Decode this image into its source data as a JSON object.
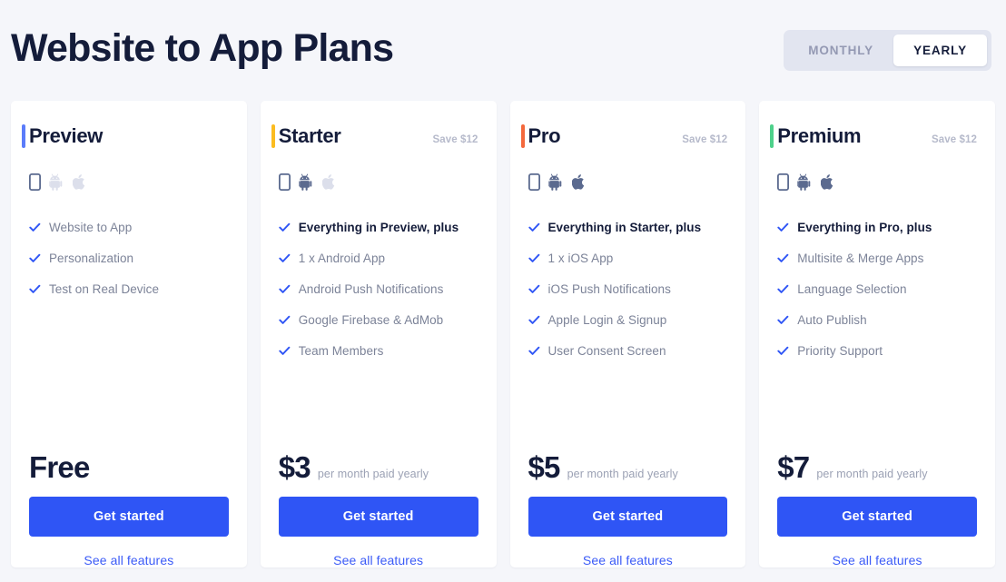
{
  "header": {
    "title": "Website to App Plans",
    "billing_toggle": {
      "monthly_label": "MONTHLY",
      "yearly_label": "YEARLY",
      "selected": "YEARLY"
    }
  },
  "colors": {
    "page_background": "#f5f6fa",
    "card_background": "#ffffff",
    "title": "#141c3a",
    "cta": "#2f55f5",
    "link": "#3b5bf7",
    "check": "#2f55f5",
    "muted_text": "#7c8398",
    "save_text": "#b6bacb",
    "platform_on": "#5b6a8f",
    "platform_off": "#dcdfeb"
  },
  "plans": [
    {
      "name": "Preview",
      "accent_color": "#5b7cfa",
      "save_label": "",
      "platforms": {
        "mobile": true,
        "android": false,
        "apple": false
      },
      "features": [
        {
          "text": "Website to App",
          "emphasis": false
        },
        {
          "text": "Personalization",
          "emphasis": false
        },
        {
          "text": "Test on Real Device",
          "emphasis": false
        }
      ],
      "price_amount": "Free",
      "price_note": "",
      "cta_label": "Get started",
      "see_all_label": "See all features"
    },
    {
      "name": "Starter",
      "accent_color": "#fbbc20",
      "save_label": "Save $12",
      "platforms": {
        "mobile": true,
        "android": true,
        "apple": false
      },
      "features": [
        {
          "text": "Everything in Preview, plus",
          "emphasis": true
        },
        {
          "text": "1 x Android App",
          "emphasis": false
        },
        {
          "text": "Android Push Notifications",
          "emphasis": false
        },
        {
          "text": "Google Firebase & AdMob",
          "emphasis": false
        },
        {
          "text": "Team Members",
          "emphasis": false
        }
      ],
      "price_amount": "$3",
      "price_note": "per month paid yearly",
      "cta_label": "Get started",
      "see_all_label": "See all features"
    },
    {
      "name": "Pro",
      "accent_color": "#f4683c",
      "save_label": "Save $12",
      "platforms": {
        "mobile": true,
        "android": true,
        "apple": true
      },
      "features": [
        {
          "text": "Everything in Starter, plus",
          "emphasis": true
        },
        {
          "text": "1 x iOS App",
          "emphasis": false
        },
        {
          "text": "iOS Push Notifications",
          "emphasis": false
        },
        {
          "text": "Apple Login & Signup",
          "emphasis": false
        },
        {
          "text": "User Consent Screen",
          "emphasis": false
        }
      ],
      "price_amount": "$5",
      "price_note": "per month paid yearly",
      "cta_label": "Get started",
      "see_all_label": "See all features"
    },
    {
      "name": "Premium",
      "accent_color": "#4ed18b",
      "save_label": "Save $12",
      "platforms": {
        "mobile": true,
        "android": true,
        "apple": true
      },
      "features": [
        {
          "text": "Everything in Pro, plus",
          "emphasis": true
        },
        {
          "text": "Multisite & Merge Apps",
          "emphasis": false
        },
        {
          "text": "Language Selection",
          "emphasis": false
        },
        {
          "text": "Auto Publish",
          "emphasis": false
        },
        {
          "text": "Priority Support",
          "emphasis": false
        }
      ],
      "price_amount": "$7",
      "price_note": "per month paid yearly",
      "cta_label": "Get started",
      "see_all_label": "See all features"
    }
  ]
}
